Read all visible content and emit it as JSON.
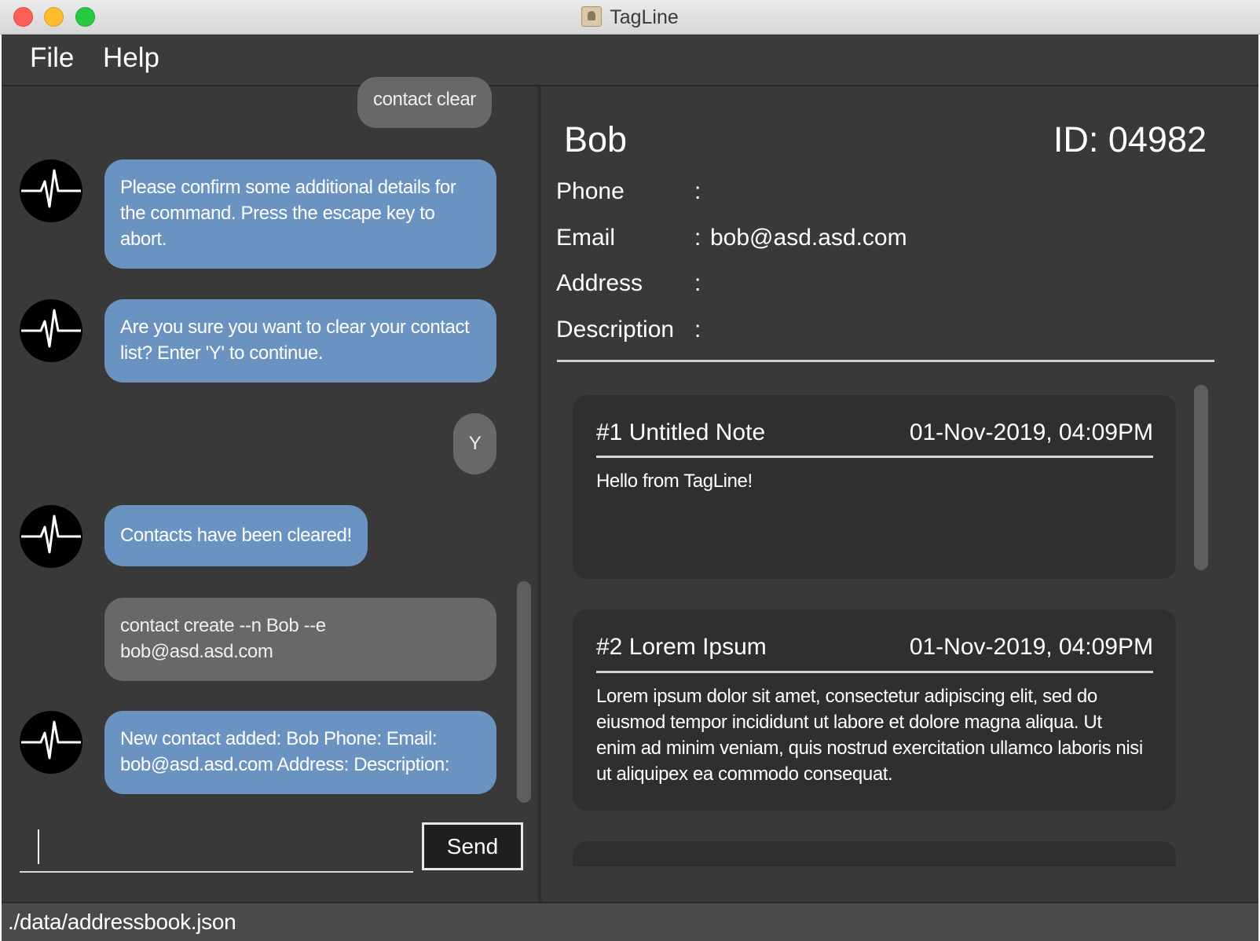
{
  "window": {
    "title": "TagLine",
    "icon": "app-icon"
  },
  "menu": {
    "file": "File",
    "help": "Help"
  },
  "chat": {
    "messages": [
      {
        "sender": "user",
        "text": "contact clear"
      },
      {
        "sender": "bot",
        "text": "Please confirm some additional details for the command. Press the escape key to abort."
      },
      {
        "sender": "bot",
        "text": "Are you sure you want to clear your contact list? Enter 'Y' to continue."
      },
      {
        "sender": "user",
        "text": "Y"
      },
      {
        "sender": "bot",
        "text": "Contacts have been cleared!"
      },
      {
        "sender": "user",
        "text": "contact create --n Bob --e bob@asd.asd.com"
      },
      {
        "sender": "bot",
        "text": "New contact added: Bob Phone:  Email: bob@asd.asd.com Address:  Description:"
      }
    ],
    "avatar_icon": "heartbeat-icon",
    "input_value": "",
    "send_label": "Send"
  },
  "contact": {
    "name": "Bob",
    "id": "ID: 04982",
    "fields": [
      {
        "label": "Phone",
        "value": ""
      },
      {
        "label": "Email",
        "value": "bob@asd.asd.com"
      },
      {
        "label": "Address",
        "value": ""
      },
      {
        "label": "Description",
        "value": ""
      }
    ],
    "notes": [
      {
        "title": "#1 Untitled Note",
        "date": "01-Nov-2019, 04:09PM",
        "body": "Hello from TagLine!"
      },
      {
        "title": "#2 Lorem Ipsum",
        "date": "01-Nov-2019, 04:09PM",
        "body": "Lorem ipsum dolor sit amet, consectetur adipiscing elit, sed do eiusmod tempor incididunt ut labore et dolore magna aliqua. Ut enim ad minim veniam, quis nostrud exercitation ullamco laboris nisi ut aliquipex ea commodo consequat."
      }
    ]
  },
  "status": {
    "file_path": "./data/addressbook.json"
  },
  "colors": {
    "bot_bubble": "#6a93c2",
    "user_bubble": "#686868",
    "panel_bg": "#393939",
    "note_bg": "#2f2f2f",
    "status_bg": "#4a4a4a"
  }
}
